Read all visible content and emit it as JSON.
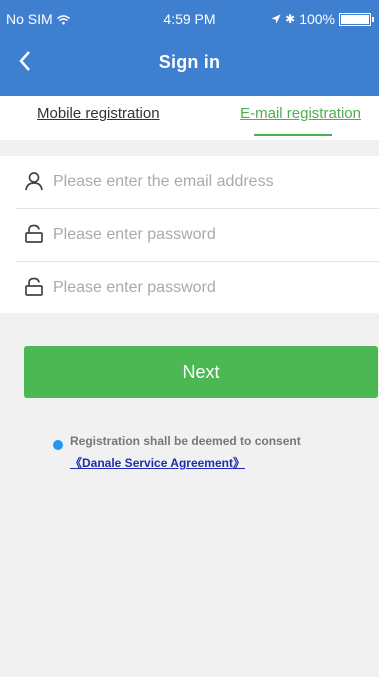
{
  "status_bar": {
    "carrier": "No SIM",
    "time": "4:59 PM",
    "battery": "100%"
  },
  "header": {
    "title": "Sign in"
  },
  "tabs": [
    {
      "label": "Mobile registration"
    },
    {
      "label": "E-mail registration"
    }
  ],
  "form": {
    "email_placeholder": "Please enter the email address",
    "password_placeholder": "Please enter password",
    "confirm_placeholder": "Please enter password"
  },
  "next_label": "Next",
  "consent": {
    "text": "Registration shall be deemed to consent",
    "link": "《Danale Service Agreement》"
  },
  "colors": {
    "header": "#3f7fd0",
    "accent_green": "#4cb853",
    "link": "#1e2db0",
    "dot": "#2196f3"
  },
  "icons": {
    "user": "user-icon",
    "lock": "lock-icon",
    "back": "back-chevron-icon"
  }
}
